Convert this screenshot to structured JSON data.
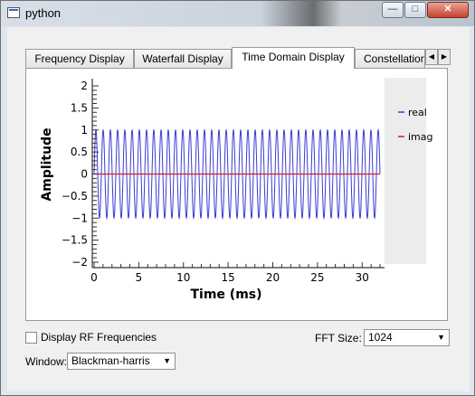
{
  "window": {
    "title": "python",
    "minimize": "—",
    "maximize": "□",
    "close": "✕"
  },
  "tabs": [
    {
      "label": "Frequency Display"
    },
    {
      "label": "Waterfall Display"
    },
    {
      "label": "Time Domain Display"
    },
    {
      "label": "Constellation"
    }
  ],
  "tab_scroll": {
    "left": "◀",
    "right": "▶"
  },
  "controls": {
    "rf_checkbox_label": "Display RF Frequencies",
    "rf_checked": false,
    "fft_label": "FFT Size:",
    "fft_value": "1024",
    "window_label": "Window:",
    "window_value": "Blackman-harris"
  },
  "chart_data": {
    "type": "line",
    "xlabel": "Time (ms)",
    "ylabel": "Amplitude",
    "xlim": [
      0,
      32
    ],
    "ylim": [
      -2,
      2
    ],
    "xticks": [
      0,
      5,
      10,
      15,
      20,
      25,
      30
    ],
    "yticks": [
      2,
      1.5,
      1,
      0.5,
      0,
      -0.5,
      -1,
      -1.5,
      -2
    ],
    "legend": "right",
    "series": [
      {
        "name": "real",
        "color": "#3b3bd6",
        "signal": "sinusoid",
        "amplitude": 1.0,
        "cycles_in_window": 39.5
      },
      {
        "name": "imag",
        "color": "#d02020",
        "signal": "constant",
        "value": 0
      }
    ]
  }
}
